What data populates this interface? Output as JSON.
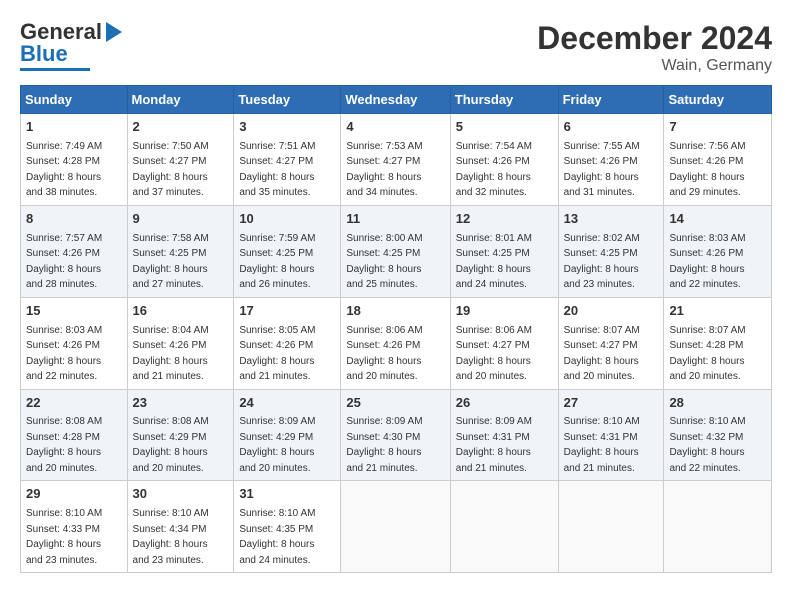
{
  "logo": {
    "general": "General",
    "blue": "Blue"
  },
  "header": {
    "month": "December 2024",
    "location": "Wain, Germany"
  },
  "weekdays": [
    "Sunday",
    "Monday",
    "Tuesday",
    "Wednesday",
    "Thursday",
    "Friday",
    "Saturday"
  ],
  "weeks": [
    [
      {
        "day": "1",
        "sunrise": "7:49 AM",
        "sunset": "4:28 PM",
        "daylight": "8 hours and 38 minutes."
      },
      {
        "day": "2",
        "sunrise": "7:50 AM",
        "sunset": "4:27 PM",
        "daylight": "8 hours and 37 minutes."
      },
      {
        "day": "3",
        "sunrise": "7:51 AM",
        "sunset": "4:27 PM",
        "daylight": "8 hours and 35 minutes."
      },
      {
        "day": "4",
        "sunrise": "7:53 AM",
        "sunset": "4:27 PM",
        "daylight": "8 hours and 34 minutes."
      },
      {
        "day": "5",
        "sunrise": "7:54 AM",
        "sunset": "4:26 PM",
        "daylight": "8 hours and 32 minutes."
      },
      {
        "day": "6",
        "sunrise": "7:55 AM",
        "sunset": "4:26 PM",
        "daylight": "8 hours and 31 minutes."
      },
      {
        "day": "7",
        "sunrise": "7:56 AM",
        "sunset": "4:26 PM",
        "daylight": "8 hours and 29 minutes."
      }
    ],
    [
      {
        "day": "8",
        "sunrise": "7:57 AM",
        "sunset": "4:26 PM",
        "daylight": "8 hours and 28 minutes."
      },
      {
        "day": "9",
        "sunrise": "7:58 AM",
        "sunset": "4:25 PM",
        "daylight": "8 hours and 27 minutes."
      },
      {
        "day": "10",
        "sunrise": "7:59 AM",
        "sunset": "4:25 PM",
        "daylight": "8 hours and 26 minutes."
      },
      {
        "day": "11",
        "sunrise": "8:00 AM",
        "sunset": "4:25 PM",
        "daylight": "8 hours and 25 minutes."
      },
      {
        "day": "12",
        "sunrise": "8:01 AM",
        "sunset": "4:25 PM",
        "daylight": "8 hours and 24 minutes."
      },
      {
        "day": "13",
        "sunrise": "8:02 AM",
        "sunset": "4:25 PM",
        "daylight": "8 hours and 23 minutes."
      },
      {
        "day": "14",
        "sunrise": "8:03 AM",
        "sunset": "4:26 PM",
        "daylight": "8 hours and 22 minutes."
      }
    ],
    [
      {
        "day": "15",
        "sunrise": "8:03 AM",
        "sunset": "4:26 PM",
        "daylight": "8 hours and 22 minutes."
      },
      {
        "day": "16",
        "sunrise": "8:04 AM",
        "sunset": "4:26 PM",
        "daylight": "8 hours and 21 minutes."
      },
      {
        "day": "17",
        "sunrise": "8:05 AM",
        "sunset": "4:26 PM",
        "daylight": "8 hours and 21 minutes."
      },
      {
        "day": "18",
        "sunrise": "8:06 AM",
        "sunset": "4:26 PM",
        "daylight": "8 hours and 20 minutes."
      },
      {
        "day": "19",
        "sunrise": "8:06 AM",
        "sunset": "4:27 PM",
        "daylight": "8 hours and 20 minutes."
      },
      {
        "day": "20",
        "sunrise": "8:07 AM",
        "sunset": "4:27 PM",
        "daylight": "8 hours and 20 minutes."
      },
      {
        "day": "21",
        "sunrise": "8:07 AM",
        "sunset": "4:28 PM",
        "daylight": "8 hours and 20 minutes."
      }
    ],
    [
      {
        "day": "22",
        "sunrise": "8:08 AM",
        "sunset": "4:28 PM",
        "daylight": "8 hours and 20 minutes."
      },
      {
        "day": "23",
        "sunrise": "8:08 AM",
        "sunset": "4:29 PM",
        "daylight": "8 hours and 20 minutes."
      },
      {
        "day": "24",
        "sunrise": "8:09 AM",
        "sunset": "4:29 PM",
        "daylight": "8 hours and 20 minutes."
      },
      {
        "day": "25",
        "sunrise": "8:09 AM",
        "sunset": "4:30 PM",
        "daylight": "8 hours and 21 minutes."
      },
      {
        "day": "26",
        "sunrise": "8:09 AM",
        "sunset": "4:31 PM",
        "daylight": "8 hours and 21 minutes."
      },
      {
        "day": "27",
        "sunrise": "8:10 AM",
        "sunset": "4:31 PM",
        "daylight": "8 hours and 21 minutes."
      },
      {
        "day": "28",
        "sunrise": "8:10 AM",
        "sunset": "4:32 PM",
        "daylight": "8 hours and 22 minutes."
      }
    ],
    [
      {
        "day": "29",
        "sunrise": "8:10 AM",
        "sunset": "4:33 PM",
        "daylight": "8 hours and 23 minutes."
      },
      {
        "day": "30",
        "sunrise": "8:10 AM",
        "sunset": "4:34 PM",
        "daylight": "8 hours and 23 minutes."
      },
      {
        "day": "31",
        "sunrise": "8:10 AM",
        "sunset": "4:35 PM",
        "daylight": "8 hours and 24 minutes."
      },
      null,
      null,
      null,
      null
    ]
  ]
}
